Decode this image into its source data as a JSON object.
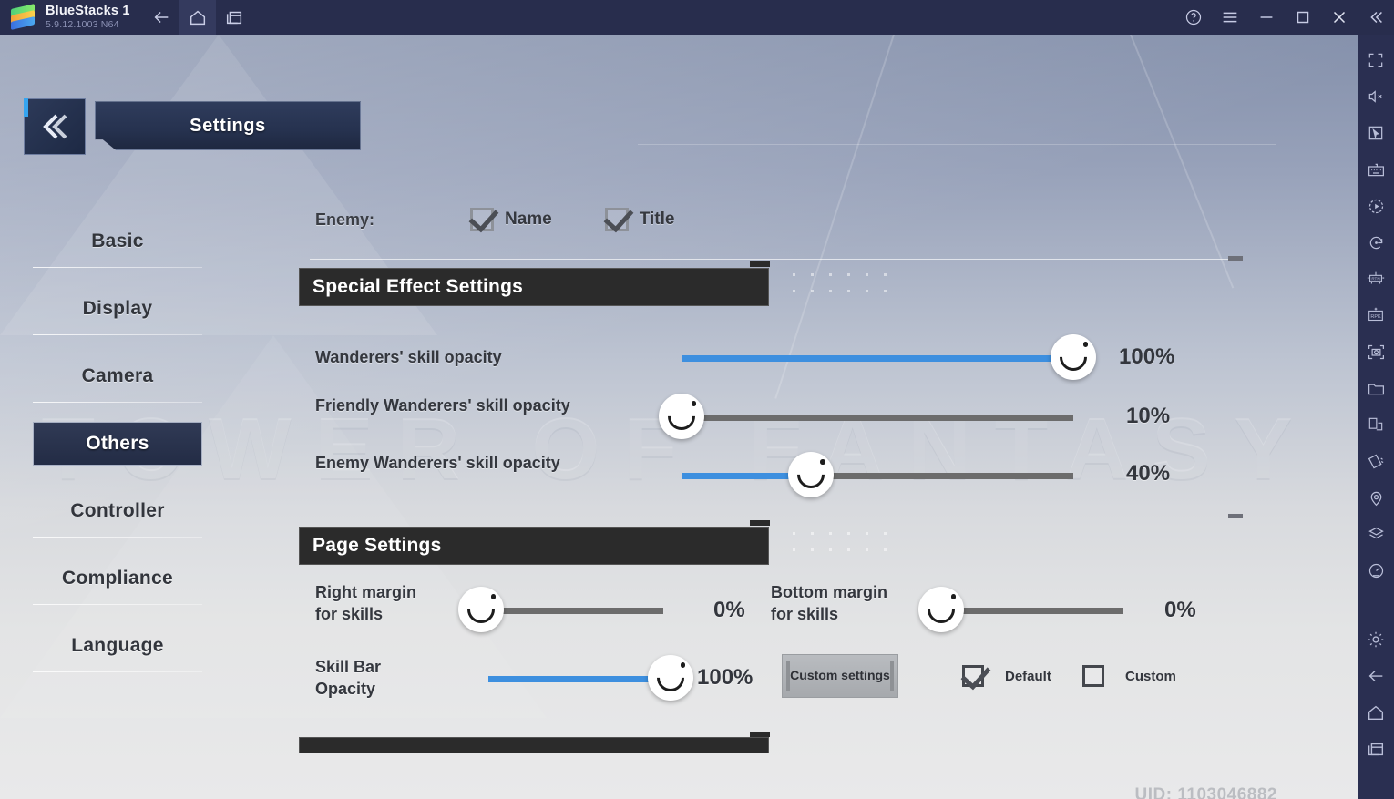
{
  "titlebar": {
    "app_name": "BlueStacks 1",
    "version": "5.9.12.1003  N64",
    "nav": [
      {
        "name": "back-icon",
        "label": "Back"
      },
      {
        "name": "home-icon",
        "label": "Home"
      },
      {
        "name": "recents-icon",
        "label": "Recents"
      }
    ],
    "window_controls": [
      {
        "name": "help-icon",
        "label": "Help"
      },
      {
        "name": "menu-icon",
        "label": "Menu"
      },
      {
        "name": "minimize-icon",
        "label": "Minimize"
      },
      {
        "name": "maximize-icon",
        "label": "Maximize"
      },
      {
        "name": "close-icon",
        "label": "Close"
      },
      {
        "name": "collapse-icon",
        "label": "Collapse"
      }
    ]
  },
  "sidebar": {
    "items": [
      {
        "name": "fullscreen-icon",
        "label": "Fullscreen"
      },
      {
        "name": "mute-icon",
        "label": "Mute"
      },
      {
        "name": "cursor-icon",
        "label": "Pointer"
      },
      {
        "name": "keyboard-icon",
        "label": "Game controls"
      },
      {
        "name": "macro-play-icon",
        "label": "Macro recorder"
      },
      {
        "name": "rotate-icon",
        "label": "Rotate"
      },
      {
        "name": "rtn-icon",
        "label": "Real-time translation"
      },
      {
        "name": "rpk-icon",
        "label": "RPK install"
      },
      {
        "name": "screenshot-icon",
        "label": "Screenshot"
      },
      {
        "name": "folder-icon",
        "label": "Media manager"
      },
      {
        "name": "multi-window-icon",
        "label": "Multi-instance"
      },
      {
        "name": "shake-icon",
        "label": "Shake"
      },
      {
        "name": "location-icon",
        "label": "Location"
      },
      {
        "name": "layers-icon",
        "label": "Layers"
      },
      {
        "name": "performance-icon",
        "label": "Performance"
      },
      {
        "name": "gear-icon",
        "label": "Settings"
      },
      {
        "name": "back-icon",
        "label": "Back"
      },
      {
        "name": "home-icon",
        "label": "Home"
      },
      {
        "name": "recents-icon",
        "label": "Recents"
      }
    ]
  },
  "game": {
    "watermark": "TOWER OF FANTASY",
    "header": {
      "back_label": "Back",
      "title": "Settings"
    },
    "left_nav": [
      {
        "label": "Basic",
        "selected": false
      },
      {
        "label": "Display",
        "selected": false
      },
      {
        "label": "Camera",
        "selected": false
      },
      {
        "label": "Others",
        "selected": true
      },
      {
        "label": "Controller",
        "selected": false
      },
      {
        "label": "Compliance",
        "selected": false
      },
      {
        "label": "Language",
        "selected": false
      }
    ],
    "enemy_row": {
      "label": "Enemy:",
      "options": [
        {
          "label": "Name",
          "checked": true
        },
        {
          "label": "Title",
          "checked": true
        }
      ]
    },
    "sections": [
      {
        "title": "Special Effect Settings",
        "sliders": [
          {
            "label": "Wanderers' skill opacity",
            "value": 100,
            "display": "100%"
          },
          {
            "label": "Friendly Wanderers' skill opacity",
            "value": 10,
            "display": "10%"
          },
          {
            "label": "Enemy Wanderers' skill opacity",
            "value": 40,
            "display": "40%"
          }
        ]
      },
      {
        "title": "Page Settings",
        "sliders": [
          {
            "label": "Right margin for skills",
            "value": 0,
            "display": "0%"
          },
          {
            "label": "Bottom margin for skills",
            "value": 0,
            "display": "0%"
          },
          {
            "label": "Skill Bar Opacity",
            "value": 100,
            "display": "100%"
          }
        ],
        "custom_button": "Custom settings",
        "options": [
          {
            "label": "Default",
            "checked": true
          },
          {
            "label": "Custom",
            "checked": false
          }
        ]
      }
    ],
    "uid": "UID: 1103046882"
  },
  "colors": {
    "accent_blue": "#3d8fdf",
    "track_gray": "#6c6c6c",
    "panel_dark": "#2b2b2b",
    "titlebar": "#282d4d",
    "sidebar": "#2a2f51"
  }
}
